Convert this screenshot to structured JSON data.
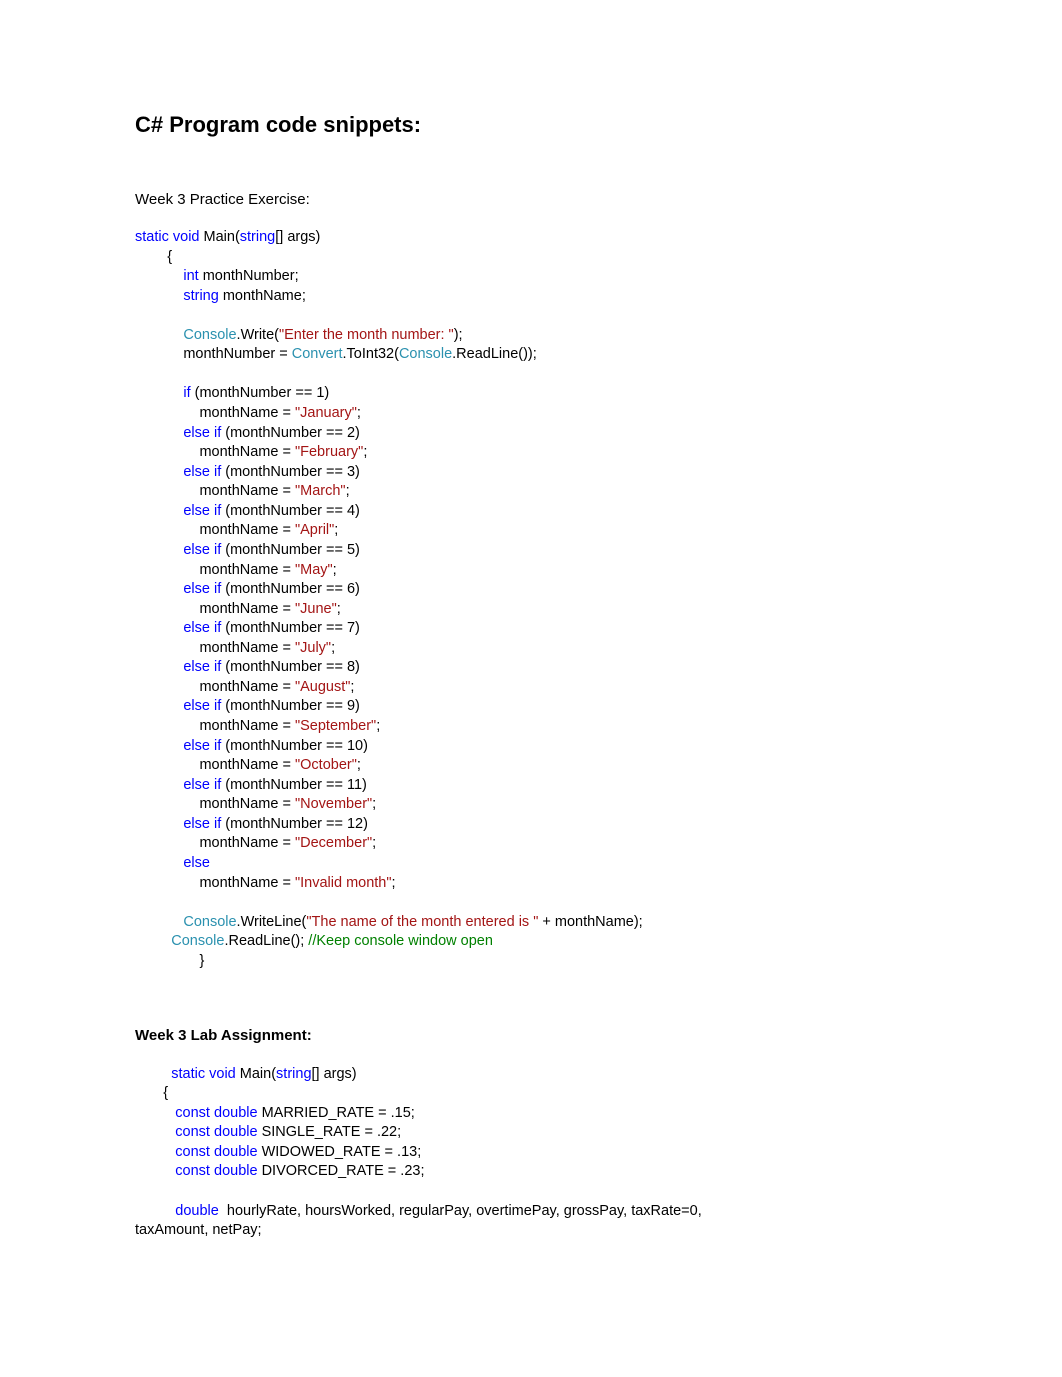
{
  "title": "C# Program code snippets:",
  "section1": {
    "label": "Week 3 Practice Exercise:",
    "code": {
      "l01_kw1": "static",
      "l01_kw2": "void",
      "l01_txt": " Main(",
      "l01_kw3": "string",
      "l01_txt2": "[] args)",
      "l02": "        {",
      "l03_kw": "int",
      "l03_txt": " monthNumber;",
      "l04_kw": "string",
      "l04_txt": " monthName;",
      "l05_typ": "Console",
      "l05_txt": ".Write(",
      "l05_str": "\"Enter the month number: \"",
      "l05_txt2": ");",
      "l06_txt": "monthNumber = ",
      "l06_typ": "Convert",
      "l06_txt2": ".ToInt32(",
      "l06_typ2": "Console",
      "l06_txt3": ".ReadLine());",
      "l07_kw": "if",
      "l07_txt": " (monthNumber == 1)",
      "l08_txt": "monthName = ",
      "l08_str": "\"January\"",
      "l08_txt2": ";",
      "l09_kw": "else if",
      "l09_txt": " (monthNumber == 2)",
      "l10_txt": "monthName = ",
      "l10_str": "\"February\"",
      "l10_txt2": ";",
      "l11_kw": "else if",
      "l11_txt": " (monthNumber == 3)",
      "l12_txt": "monthName = ",
      "l12_str": "\"March\"",
      "l12_txt2": ";",
      "l13_kw": "else if",
      "l13_txt": " (monthNumber == 4)",
      "l14_txt": "monthName = ",
      "l14_str": "\"April\"",
      "l14_txt2": ";",
      "l15_kw": "else if",
      "l15_txt": " (monthNumber == 5)",
      "l16_txt": "monthName = ",
      "l16_str": "\"May\"",
      "l16_txt2": ";",
      "l17_kw": "else if",
      "l17_txt": " (monthNumber == 6)",
      "l18_txt": "monthName = ",
      "l18_str": "\"June\"",
      "l18_txt2": ";",
      "l19_kw": "else if",
      "l19_txt": " (monthNumber == 7)",
      "l20_txt": "monthName = ",
      "l20_str": "\"July\"",
      "l20_txt2": ";",
      "l21_kw": "else if",
      "l21_txt": " (monthNumber == 8)",
      "l22_txt": "monthName = ",
      "l22_str": "\"August\"",
      "l22_txt2": ";",
      "l23_kw": "else if",
      "l23_txt": " (monthNumber == 9)",
      "l24_txt": "monthName = ",
      "l24_str": "\"September\"",
      "l24_txt2": ";",
      "l25_kw": "else if",
      "l25_txt": " (monthNumber == 10)",
      "l26_txt": "monthName = ",
      "l26_str": "\"October\"",
      "l26_txt2": ";",
      "l27_kw": "else if",
      "l27_txt": " (monthNumber == 11)",
      "l28_txt": "monthName = ",
      "l28_str": "\"November\"",
      "l28_txt2": ";",
      "l29_kw": "else if",
      "l29_txt": " (monthNumber == 12)",
      "l30_txt": "monthName = ",
      "l30_str": "\"December\"",
      "l30_txt2": ";",
      "l31_kw": "else",
      "l32_txt": "monthName = ",
      "l32_str": "\"Invalid month\"",
      "l32_txt2": ";",
      "l33_typ": "Console",
      "l33_txt": ".WriteLine(",
      "l33_str": "\"The name of the month entered is \"",
      "l33_txt2": " + monthName);",
      "l34_typ": "Console",
      "l34_txt": ".ReadLine(); ",
      "l34_cmt": "//Keep console window open",
      "l35": "                }"
    }
  },
  "section2": {
    "label": "Week 3 Lab Assignment:",
    "code": {
      "l01_kw1": "static",
      "l01_kw2": "void",
      "l01_txt": " Main(",
      "l01_kw3": "string",
      "l01_txt2": "[] args)",
      "l02": "       {",
      "l03_kw1": "const",
      "l03_kw2": "double",
      "l03_txt": " MARRIED_RATE = .15;",
      "l04_kw1": "const",
      "l04_kw2": "double",
      "l04_txt": " SINGLE_RATE = .22;",
      "l05_kw1": "const",
      "l05_kw2": "double",
      "l05_txt": " WIDOWED_RATE = .13;",
      "l06_kw1": "const",
      "l06_kw2": "double",
      "l06_txt": " DIVORCED_RATE = .23;",
      "l07_kw": "double",
      "l07_txt": "  hourlyRate, hoursWorked, regularPay, overtimePay, grossPay, taxRate=0,",
      "l08_txt": "taxAmount, netPay;"
    }
  }
}
